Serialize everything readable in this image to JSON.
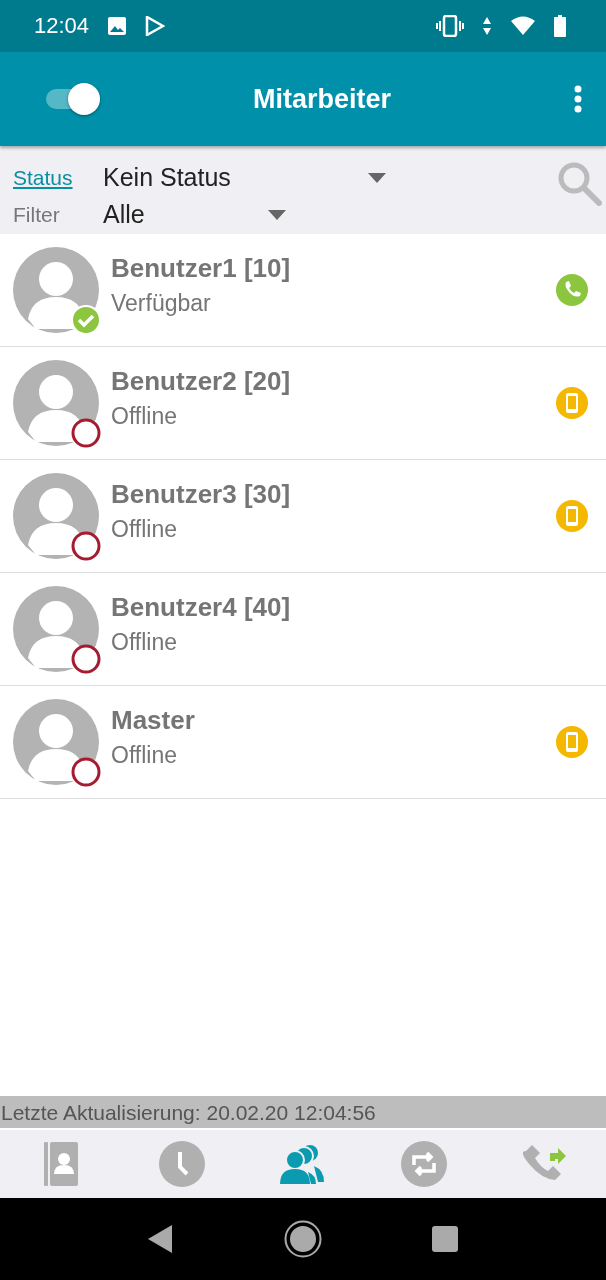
{
  "status_bar": {
    "time": "12:04"
  },
  "app_bar": {
    "title": "Mitarbeiter",
    "toggle_on": true
  },
  "filters": [
    {
      "label": "Status",
      "value": "Kein Status",
      "kind": "link"
    },
    {
      "label": "Filter",
      "value": "Alle",
      "kind": "plain"
    }
  ],
  "users": [
    {
      "name": "Benutzer1 [10]",
      "status": "Verfügbar",
      "available": true,
      "kind": "phone"
    },
    {
      "name": "Benutzer2 [20]",
      "status": "Offline",
      "available": false,
      "kind": "mobile"
    },
    {
      "name": "Benutzer3 [30]",
      "status": "Offline",
      "available": false,
      "kind": "mobile"
    },
    {
      "name": "Benutzer4 [40]",
      "status": "Offline",
      "available": false,
      "kind": "none"
    },
    {
      "name": "Master",
      "status": "Offline",
      "available": false,
      "kind": "mobile"
    }
  ],
  "last_update": "Letzte Aktualisierung: 20.02.20 12:04:56",
  "bottom_nav": [
    {
      "kind": "contacts",
      "selected": false
    },
    {
      "kind": "history",
      "selected": false
    },
    {
      "kind": "colleagues",
      "selected": true
    },
    {
      "kind": "sync",
      "selected": false
    },
    {
      "kind": "forward",
      "selected": false
    }
  ]
}
